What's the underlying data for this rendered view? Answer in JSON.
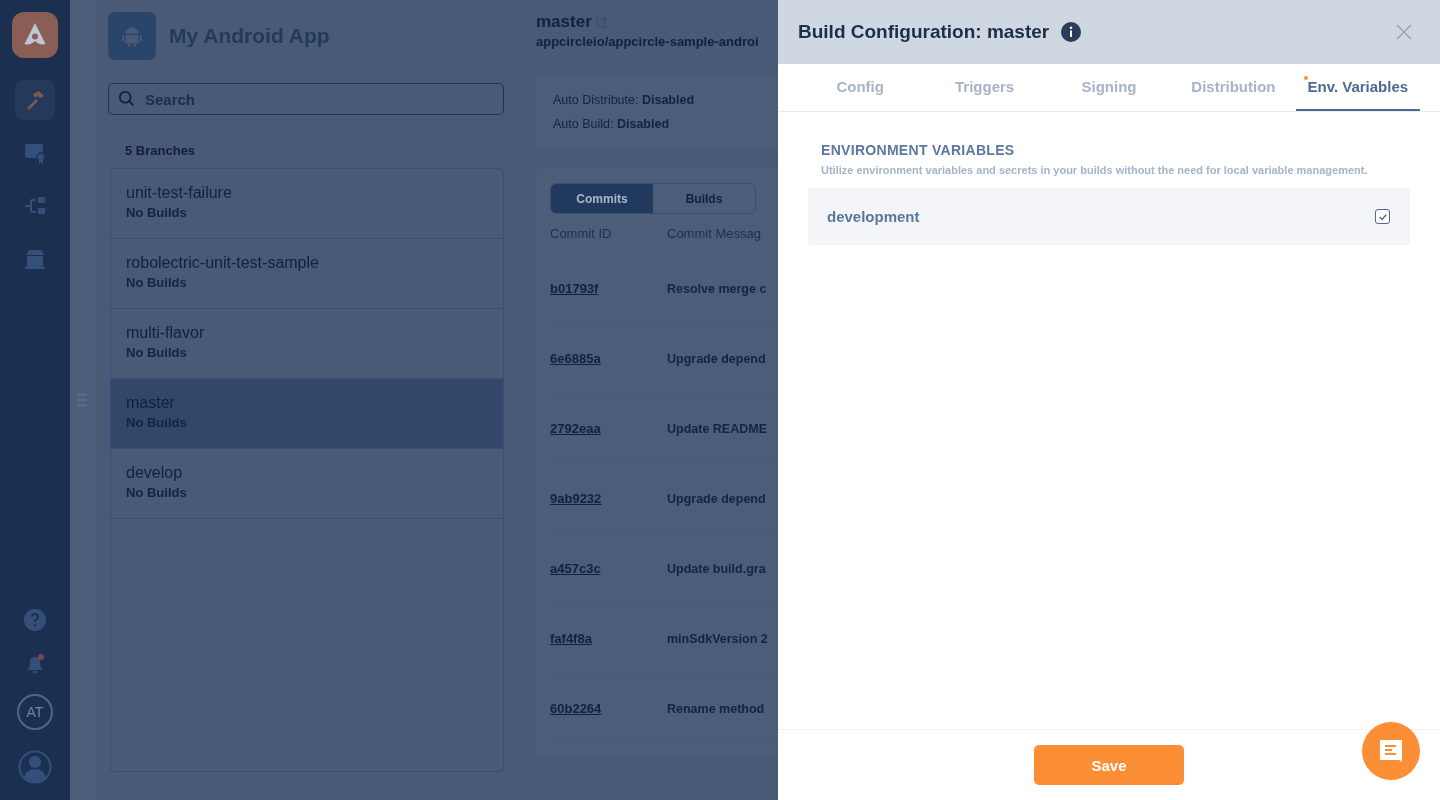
{
  "rail": {
    "items": [
      {
        "kind": "build",
        "selected": true
      },
      {
        "kind": "signing",
        "selected": false
      },
      {
        "kind": "distribution",
        "selected": false
      },
      {
        "kind": "store",
        "selected": false
      }
    ],
    "bottom": [
      {
        "kind": "help"
      },
      {
        "kind": "notifications",
        "unread": true
      },
      {
        "kind": "initials",
        "text": "AT"
      },
      {
        "kind": "profile"
      }
    ]
  },
  "app": {
    "name": "My Android App"
  },
  "search": {
    "placeholder": "Search"
  },
  "branches_count": "5 Branches",
  "branches": [
    {
      "name": "unit-test-failure",
      "status": "No Builds",
      "selected": false
    },
    {
      "name": "robolectric-unit-test-sample",
      "status": "No Builds",
      "selected": false
    },
    {
      "name": "multi-flavor",
      "status": "No Builds",
      "selected": false
    },
    {
      "name": "master",
      "status": "No Builds",
      "selected": true
    },
    {
      "name": "develop",
      "status": "No Builds",
      "selected": false
    }
  ],
  "branch_detail": {
    "title": "master",
    "repo": "appcircleio/appcircle-sample-androi",
    "settings": [
      {
        "label": "Auto Distribute:",
        "value": "Disabled"
      },
      {
        "label": "Auto Build:",
        "value": "Disabled"
      }
    ],
    "view_toggle": [
      {
        "label": "Commits",
        "selected": true
      },
      {
        "label": "Builds",
        "selected": false
      }
    ],
    "columns": [
      "Commit ID",
      "Commit Messag"
    ],
    "commits": [
      {
        "id": "b01793f",
        "message": "Resolve merge c"
      },
      {
        "id": "6e6885a",
        "message": "Upgrade depend"
      },
      {
        "id": "2792eaa",
        "message": "Update README"
      },
      {
        "id": "9ab9232",
        "message": "Upgrade depend"
      },
      {
        "id": "a457c3c",
        "message": "Update build.gra"
      },
      {
        "id": "faf4f8a",
        "message": "minSdkVersion 2"
      },
      {
        "id": "60b2264",
        "message": "Rename method"
      }
    ]
  },
  "drawer": {
    "title": "Build Configuration: master",
    "tabs": [
      {
        "label": "Config",
        "selected": false,
        "modified": false
      },
      {
        "label": "Triggers",
        "selected": false,
        "modified": false
      },
      {
        "label": "Signing",
        "selected": false,
        "modified": false
      },
      {
        "label": "Distribution",
        "selected": false,
        "modified": false
      },
      {
        "label": "Env. Variables",
        "selected": true,
        "modified": true
      }
    ],
    "section_title": "ENVIRONMENT VARIABLES",
    "section_description": "Utilize environment variables and secrets in your builds without the need for local variable management.",
    "variable_groups": [
      {
        "name": "development",
        "checked": true
      }
    ],
    "save": "Save"
  }
}
